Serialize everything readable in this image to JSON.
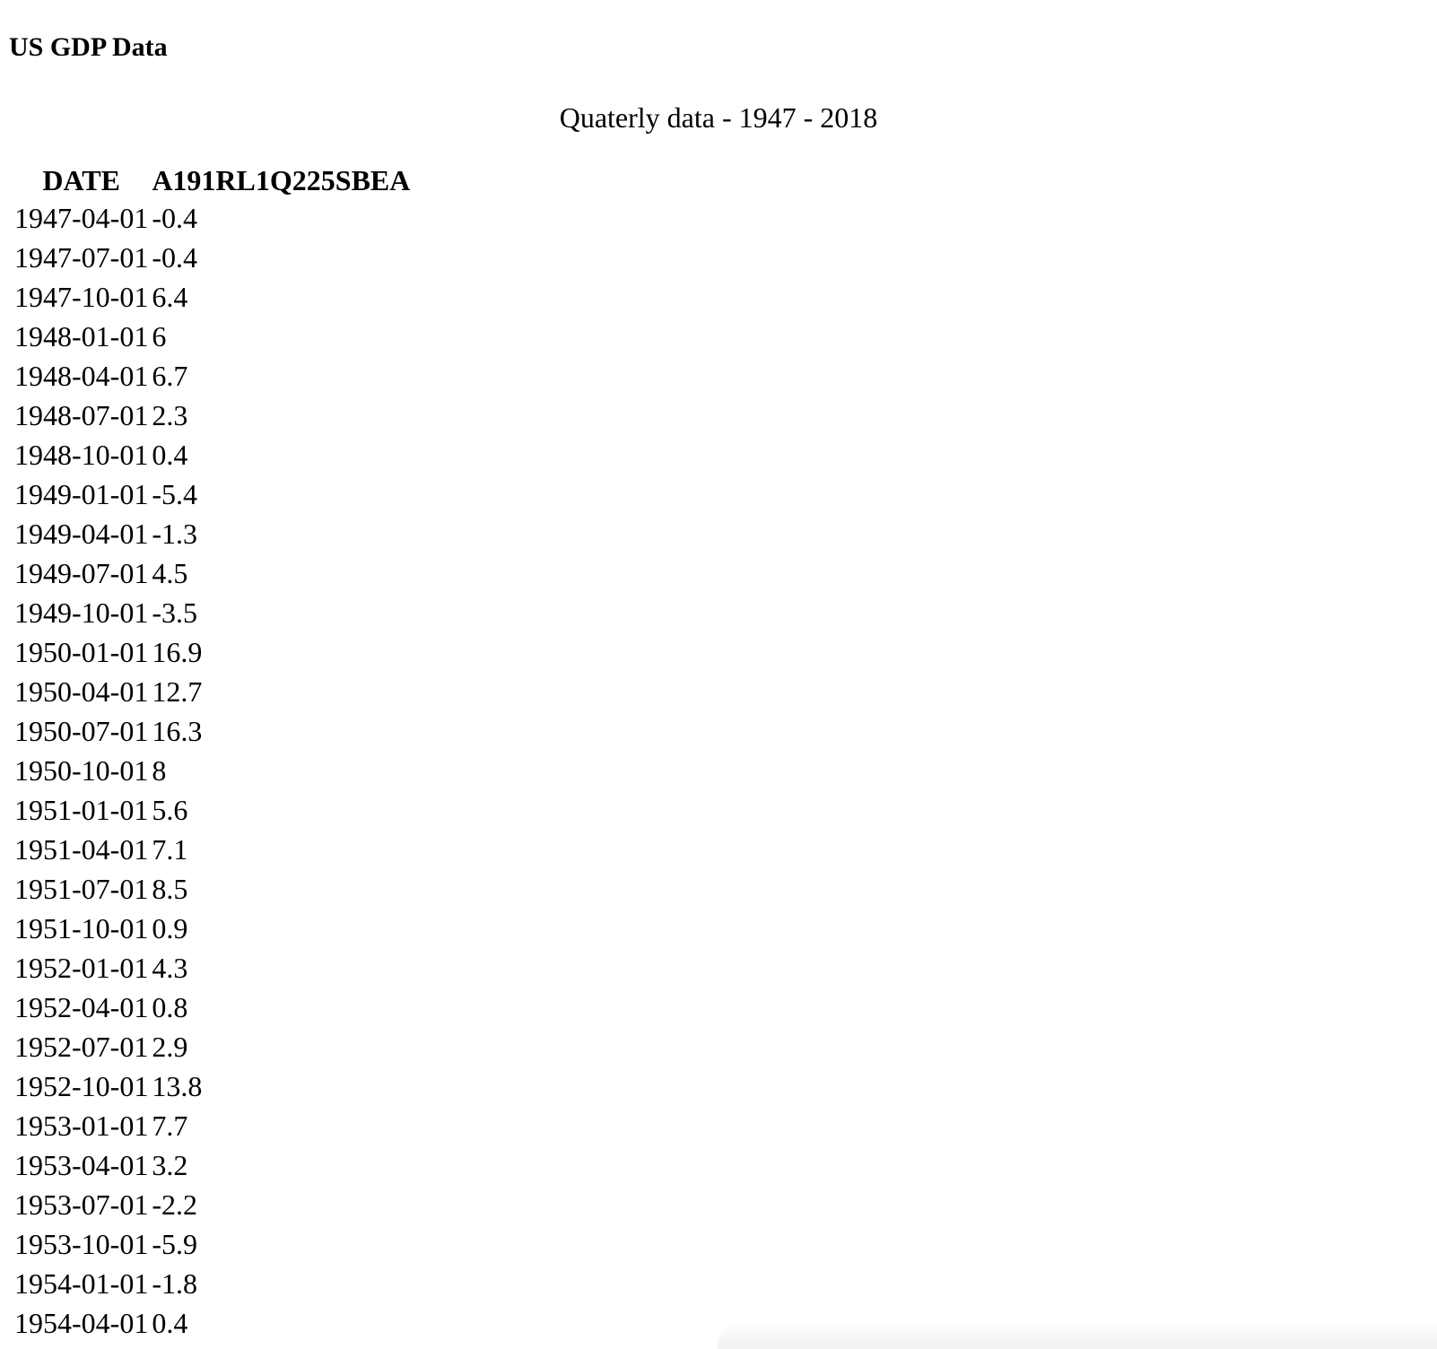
{
  "page": {
    "title": "US GDP Data",
    "subtitle": "Quaterly data - 1947 - 2018"
  },
  "table": {
    "columns": [
      "DATE",
      "A191RL1Q225SBEA"
    ],
    "rows": [
      [
        "1947-04-01",
        "-0.4"
      ],
      [
        "1947-07-01",
        "-0.4"
      ],
      [
        "1947-10-01",
        "6.4"
      ],
      [
        "1948-01-01",
        "6"
      ],
      [
        "1948-04-01",
        "6.7"
      ],
      [
        "1948-07-01",
        "2.3"
      ],
      [
        "1948-10-01",
        "0.4"
      ],
      [
        "1949-01-01",
        "-5.4"
      ],
      [
        "1949-04-01",
        "-1.3"
      ],
      [
        "1949-07-01",
        "4.5"
      ],
      [
        "1949-10-01",
        "-3.5"
      ],
      [
        "1950-01-01",
        "16.9"
      ],
      [
        "1950-04-01",
        "12.7"
      ],
      [
        "1950-07-01",
        "16.3"
      ],
      [
        "1950-10-01",
        "8"
      ],
      [
        "1951-01-01",
        "5.6"
      ],
      [
        "1951-04-01",
        "7.1"
      ],
      [
        "1951-07-01",
        "8.5"
      ],
      [
        "1951-10-01",
        "0.9"
      ],
      [
        "1952-01-01",
        "4.3"
      ],
      [
        "1952-04-01",
        "0.8"
      ],
      [
        "1952-07-01",
        "2.9"
      ],
      [
        "1952-10-01",
        "13.8"
      ],
      [
        "1953-01-01",
        "7.7"
      ],
      [
        "1953-04-01",
        "3.2"
      ],
      [
        "1953-07-01",
        "-2.2"
      ],
      [
        "1953-10-01",
        "-5.9"
      ],
      [
        "1954-01-01",
        "-1.8"
      ],
      [
        "1954-04-01",
        "0.4"
      ]
    ]
  }
}
